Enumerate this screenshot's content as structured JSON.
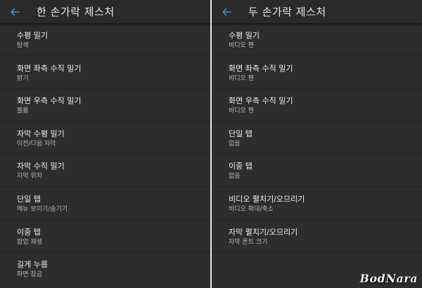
{
  "colors": {
    "background": "#2d2d2d",
    "appbar": "#2a2a2a",
    "accent": "#3d8fd6",
    "divider": "#eaeaea",
    "title_text": "#f0f0f0",
    "sub_text": "#b8b8b8"
  },
  "left": {
    "title": "한 손가락 제스처",
    "back_icon": "arrow-left-icon",
    "items": [
      {
        "title": "수평 밀기",
        "subtitle": "탐색"
      },
      {
        "title": "화면 좌측 수직 밀기",
        "subtitle": "밝기"
      },
      {
        "title": "화면 우측 수직 밀기",
        "subtitle": "볼륨"
      },
      {
        "title": "자막 수평 밀기",
        "subtitle": "이전/다음 자막"
      },
      {
        "title": "자막 수직 밀기",
        "subtitle": "자막 위치"
      },
      {
        "title": "단일 탭",
        "subtitle": "메뉴 보이기/숨기기"
      },
      {
        "title": "이중 탭",
        "subtitle": "팝업 재생"
      },
      {
        "title": "길게 누름",
        "subtitle": "화면 잠금"
      }
    ]
  },
  "right": {
    "title": "두 손가락 제스처",
    "back_icon": "arrow-left-icon",
    "items": [
      {
        "title": "수평 밀기",
        "subtitle": "비디오 팬"
      },
      {
        "title": "화면 좌측 수직 밀기",
        "subtitle": "비디오 팬"
      },
      {
        "title": "화면 우측 수직 밀기",
        "subtitle": "비디오 팬"
      },
      {
        "title": "단일 탭",
        "subtitle": "없음"
      },
      {
        "title": "이중 탭",
        "subtitle": "없음"
      },
      {
        "title": "비디오 펼치기/오므리기",
        "subtitle": "비디오 확대/축소"
      },
      {
        "title": "자막 펼치기/오므리기",
        "subtitle": "자막 폰트 크기"
      }
    ]
  },
  "watermark": "BodNara"
}
